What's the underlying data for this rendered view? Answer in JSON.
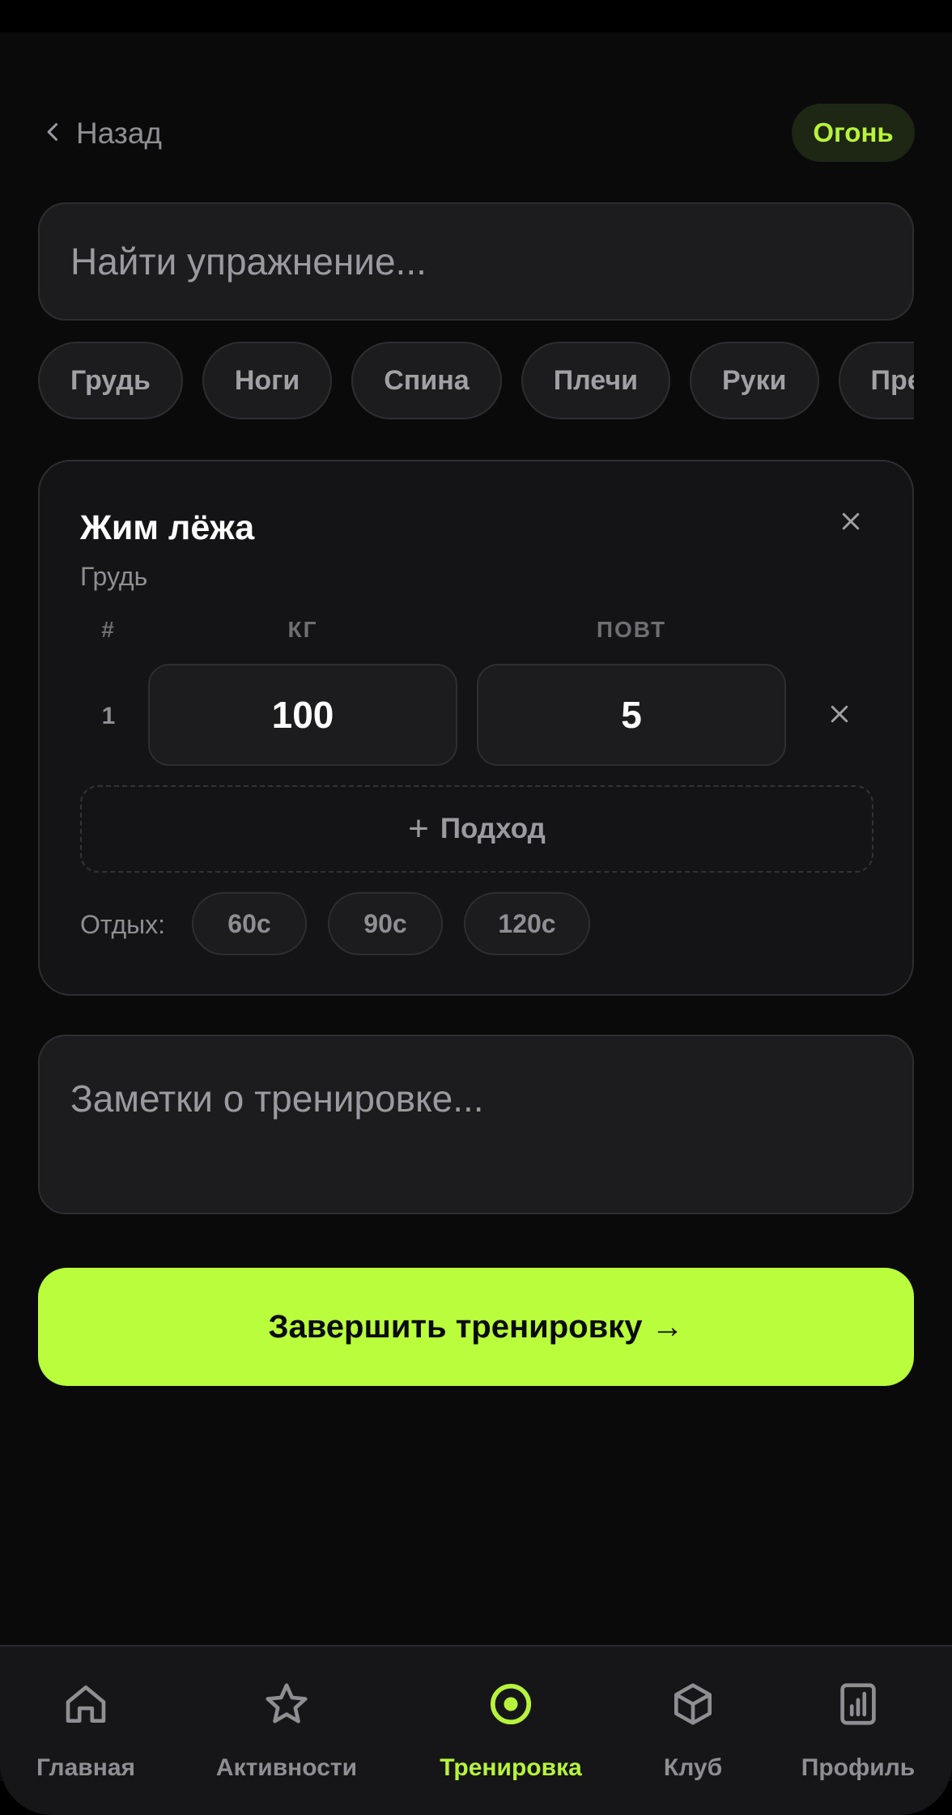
{
  "header": {
    "back_label": "Назад",
    "mode_badge": "Огонь"
  },
  "search": {
    "placeholder": "Найти упражнение..."
  },
  "muscle_chips": [
    "Грудь",
    "Ноги",
    "Спина",
    "Плечи",
    "Руки",
    "Пресс"
  ],
  "exercise": {
    "title": "Жим лёжа",
    "muscle": "Грудь",
    "columns": {
      "set": "#",
      "weight": "КГ",
      "reps": "ПОВТ"
    },
    "sets": [
      {
        "num": "1",
        "weight": "100",
        "reps": "5"
      }
    ],
    "add_set_label": "Подход",
    "rest_label": "Отдых:",
    "rest_options": [
      "60с",
      "90с",
      "120с"
    ]
  },
  "notes": {
    "placeholder": "Заметки о тренировке..."
  },
  "finish_button": "Завершить тренировку →",
  "nav": {
    "items": [
      {
        "label": "Главная",
        "icon": "home-icon"
      },
      {
        "label": "Активности",
        "icon": "star-icon"
      },
      {
        "label": "Тренировка",
        "icon": "target-icon",
        "active": true
      },
      {
        "label": "Клуб",
        "icon": "cube-icon"
      },
      {
        "label": "Профиль",
        "icon": "stats-icon"
      }
    ]
  },
  "colors": {
    "accent": "#b9fd3c",
    "background": "#0a0a0b",
    "surface": "#1c1c1e",
    "muted_text": "#8e8e93"
  }
}
